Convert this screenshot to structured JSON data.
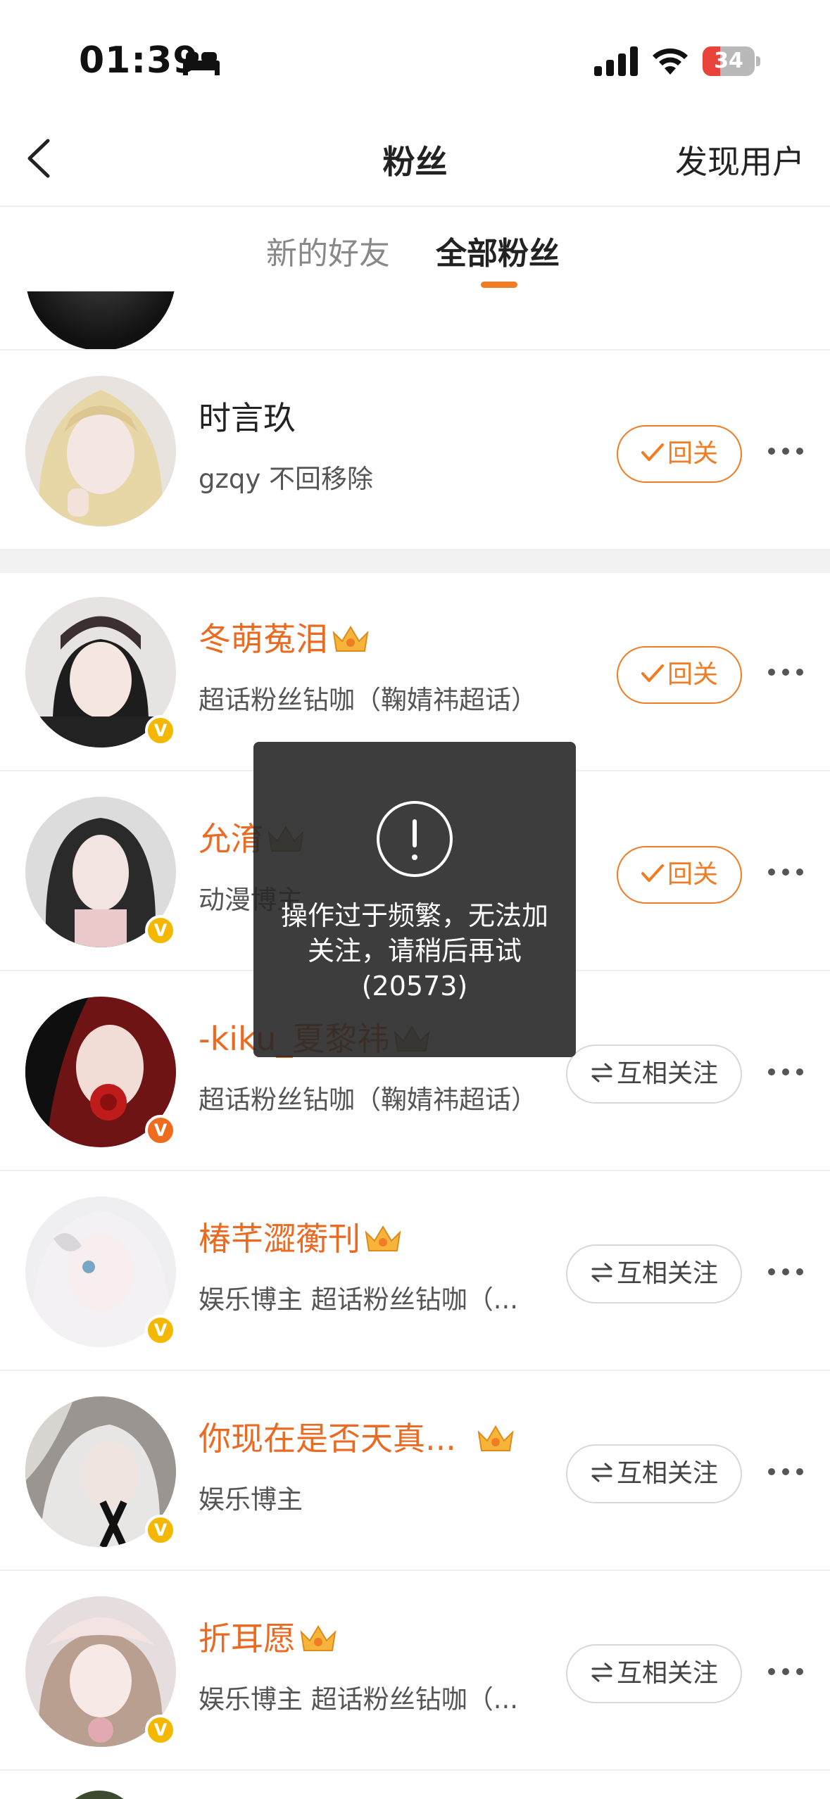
{
  "status_bar": {
    "time": "01:39",
    "battery": "34",
    "battery_percent": 0.34,
    "icons": [
      "bed-icon",
      "signal-icon",
      "wifi-icon",
      "battery-icon"
    ]
  },
  "nav": {
    "title": "粉丝",
    "right_link": "发现用户",
    "back_icon": "chevron-left-icon"
  },
  "tabs": [
    {
      "label": "新的好友",
      "active": false
    },
    {
      "label": "全部粉丝",
      "active": true
    }
  ],
  "colors": {
    "accent": "#f07c24",
    "vip_name": "#ea6a21",
    "badge_yellow": "#f5b800",
    "badge_orange": "#ef6b1e",
    "toast_bg": "#282828"
  },
  "followers": [
    {
      "name": "时言玖",
      "desc": "gzqy 不回移除",
      "button": "回关",
      "button_type": "follow",
      "vip": false,
      "badge": null
    },
    {
      "name": "冬萌菟泪",
      "desc": "超话粉丝钻咖（鞠婧祎超话）",
      "button": "回关",
      "button_type": "follow",
      "vip": true,
      "badge": "V"
    },
    {
      "name": "允淯",
      "desc": "动漫博主",
      "button": "回关",
      "button_type": "follow",
      "vip": true,
      "badge": "V"
    },
    {
      "name": "-kiku_夏黎祎",
      "desc": "超话粉丝钻咖（鞠婧祎超话）",
      "button": "互相关注",
      "button_type": "mutual",
      "vip": true,
      "badge": "V"
    },
    {
      "name": "椿芊澀蘅刊",
      "desc": "娱乐博主 超话粉丝钻咖（...",
      "button": "互相关注",
      "button_type": "mutual",
      "vip": true,
      "badge": "V"
    },
    {
      "name": "你现在是否天真...",
      "desc": "娱乐博主",
      "button": "互相关注",
      "button_type": "mutual",
      "vip": true,
      "badge": "V"
    },
    {
      "name": "折耳愿",
      "desc": "娱乐博主 超话粉丝钻咖（...",
      "button": "互相关注",
      "button_type": "mutual",
      "vip": true,
      "badge": "V"
    }
  ],
  "toast": {
    "icon": "exclamation-circle-icon",
    "message": "操作过于频繁，无法加关注，请稍后再试(20573)"
  },
  "row_icons": {
    "follow": "check-icon",
    "mutual": "mutual-arrows-icon",
    "more": "more-dots-icon",
    "crown": "crown-icon"
  }
}
